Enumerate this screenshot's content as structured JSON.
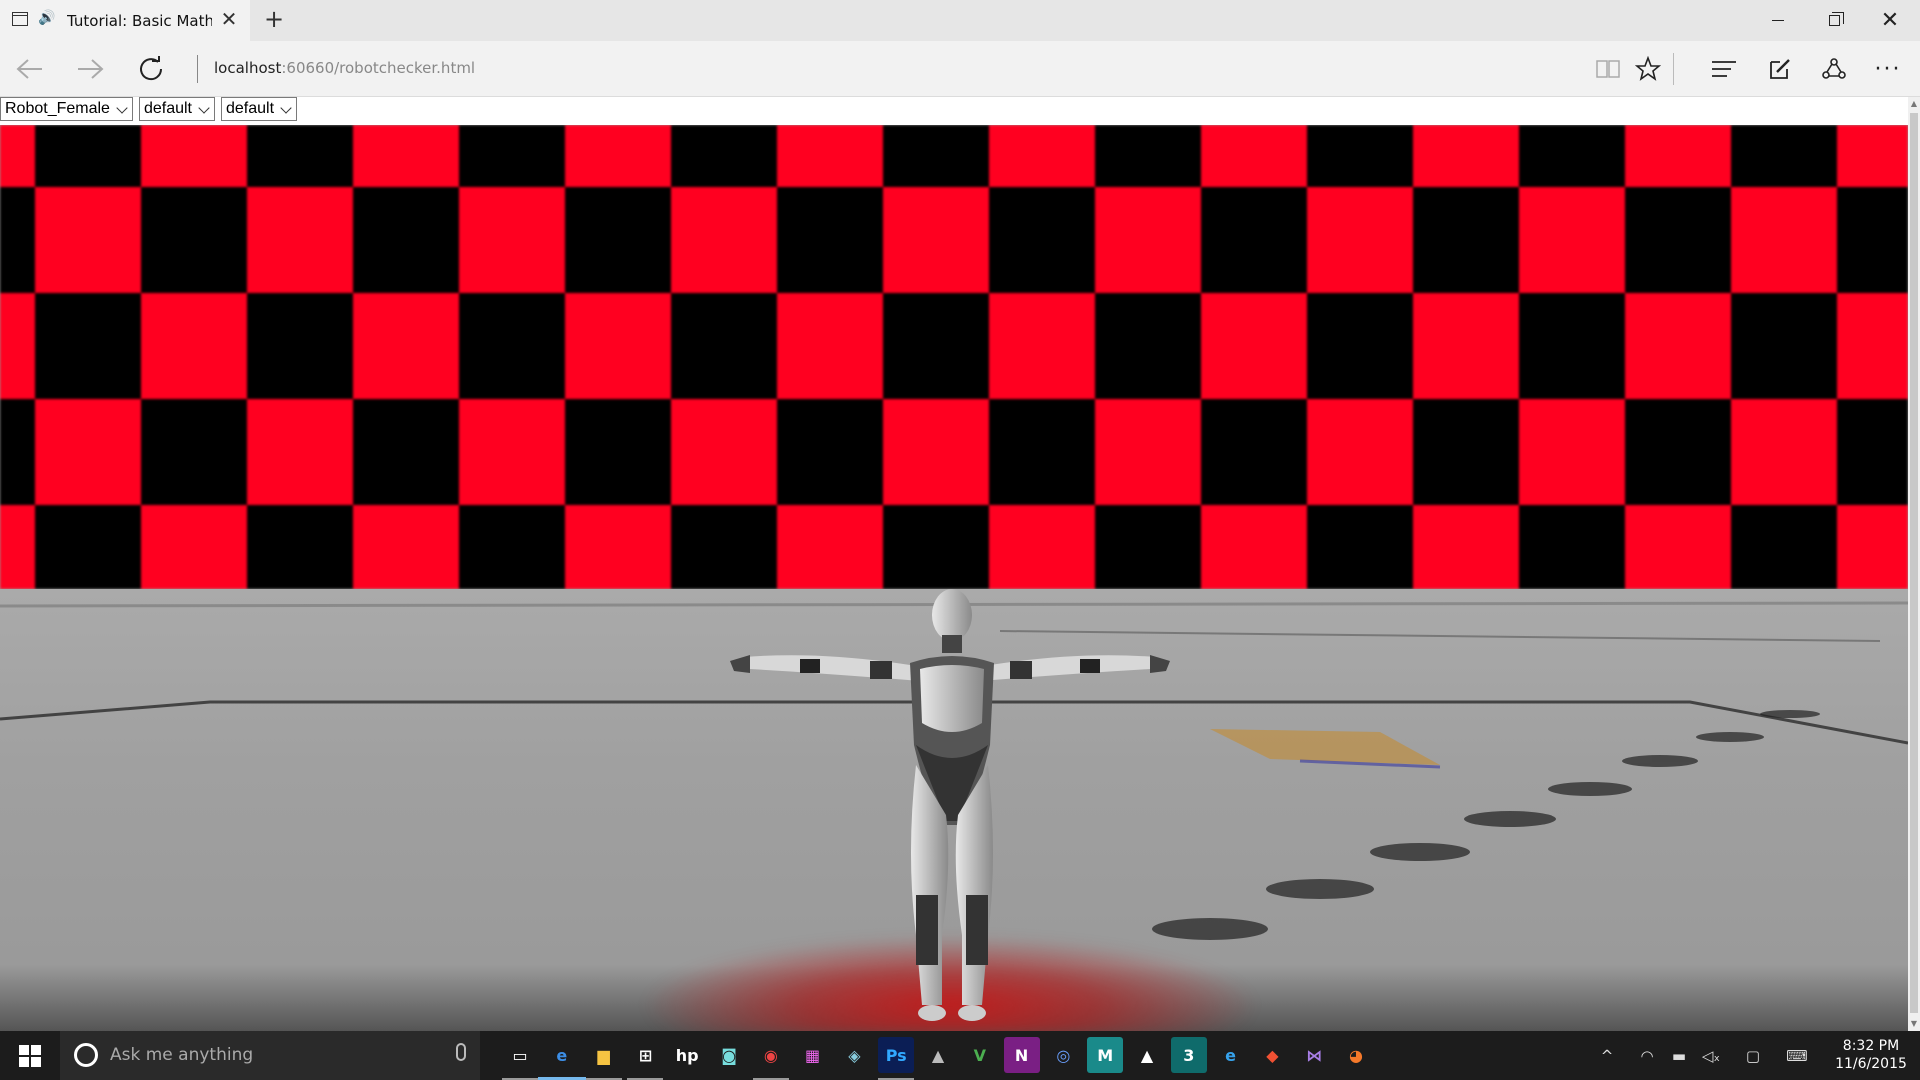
{
  "browser": {
    "tab_title": "Tutorial: Basic Math ·",
    "tab_close": "✕",
    "new_tab": "+",
    "address_host": "localhost",
    "address_rest": ":60660/robotchecker.html"
  },
  "page": {
    "selects": [
      {
        "value": "Robot_Female"
      },
      {
        "value": "default"
      },
      {
        "value": "default"
      }
    ],
    "scene": {
      "checker_colors": [
        "#ff0020",
        "#000000"
      ],
      "floor_color": "#9a9a9a"
    }
  },
  "taskbar": {
    "search_placeholder": "Ask me anything",
    "apps": [
      {
        "name": "task-view",
        "glyph": "▭",
        "color": "#1c1c1c"
      },
      {
        "name": "edge",
        "glyph": "e",
        "color": "#1c1c1c",
        "fg": "#3c8ee6"
      },
      {
        "name": "file-explorer",
        "glyph": "▆",
        "color": "#1c1c1c",
        "fg": "#f5c342"
      },
      {
        "name": "store",
        "glyph": "⊞",
        "color": "#1c1c1c"
      },
      {
        "name": "hp",
        "glyph": "hp",
        "color": "#1c1c1c"
      },
      {
        "name": "camera",
        "glyph": "◙",
        "color": "#1c1c1c",
        "fg": "#7dd"
      },
      {
        "name": "chrome",
        "glyph": "◉",
        "color": "#1c1c1c",
        "fg": "#e44"
      },
      {
        "name": "apps-grid",
        "glyph": "▦",
        "color": "#1c1c1c",
        "fg": "#e6e"
      },
      {
        "name": "sketch",
        "glyph": "◈",
        "color": "#1c1c1c",
        "fg": "#8cd"
      },
      {
        "name": "photoshop",
        "glyph": "Ps",
        "color": "#0b1e55",
        "fg": "#31a8ff"
      },
      {
        "name": "finder",
        "glyph": "▲",
        "color": "#1c1c1c",
        "fg": "#bbb"
      },
      {
        "name": "vim",
        "glyph": "V",
        "color": "#1c1c1c",
        "fg": "#4caf50"
      },
      {
        "name": "onenote",
        "glyph": "N",
        "color": "#7a1f84"
      },
      {
        "name": "blender-cycles",
        "glyph": "◎",
        "color": "#1c1c1c",
        "fg": "#6aa0ff"
      },
      {
        "name": "maya",
        "glyph": "M",
        "color": "#1a8a8a"
      },
      {
        "name": "photos",
        "glyph": "▲",
        "color": "#1c1c1c"
      },
      {
        "name": "max",
        "glyph": "3",
        "color": "#0f6b6b"
      },
      {
        "name": "internet-explorer",
        "glyph": "e",
        "color": "#1c1c1c",
        "fg": "#36a2eb"
      },
      {
        "name": "git",
        "glyph": "◆",
        "color": "#1c1c1c",
        "fg": "#f05133"
      },
      {
        "name": "visual-studio",
        "glyph": "⋈",
        "color": "#1c1c1c",
        "fg": "#a87ee6"
      },
      {
        "name": "blender",
        "glyph": "◕",
        "color": "#1c1c1c",
        "fg": "#f5792a"
      }
    ],
    "tray": {
      "chevron": "^",
      "time": "8:32 PM",
      "date": "11/6/2015"
    }
  }
}
